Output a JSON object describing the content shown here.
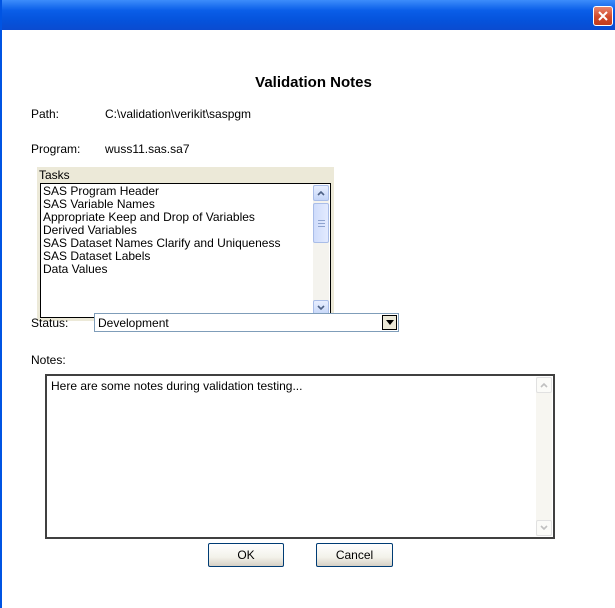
{
  "window": {
    "close_label": "✕"
  },
  "dialog": {
    "title": "Validation Notes",
    "path_label": "Path:",
    "path_value": "C:\\validation\\verikit\\saspgm",
    "program_label": "Program:",
    "program_value": "wuss11.sas.sa7",
    "tasks_label": "Tasks",
    "tasks": [
      "SAS Program Header",
      "SAS Variable Names",
      "Appropriate Keep and Drop of Variables",
      "Derived Variables",
      "SAS Dataset Names Clarify and Uniqueness",
      "SAS Dataset Labels",
      "Data Values"
    ],
    "status_label": "Status:",
    "status_value": "Development",
    "notes_label": "Notes:",
    "notes_value": "Here are some notes during validation testing...",
    "ok_label": "OK",
    "cancel_label": "Cancel"
  },
  "icons": {
    "close": "close-icon",
    "scroll_up": "up-arrow-icon",
    "scroll_down": "down-arrow-icon",
    "dropdown": "chevron-down-icon"
  },
  "colors": {
    "titlebar": "#0a5ee8",
    "close_button": "#d14a2b",
    "panel": "#ece9d8",
    "button_border": "#003c74"
  }
}
